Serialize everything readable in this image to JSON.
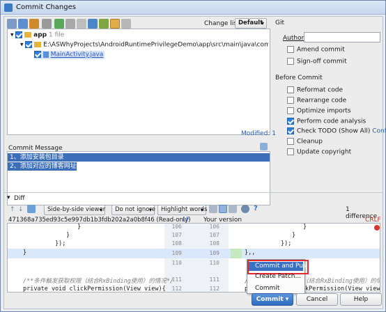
{
  "window": {
    "title": "Commit Changes"
  },
  "toolbar": {
    "changelist_label": "Change list:",
    "changelist_value": "Default"
  },
  "tree": {
    "root_label": "app",
    "root_count": "1 file",
    "path": "E:\\ASWhyProjects\\AndroidRuntimePrivilegeDemo\\app\\src\\main\\java\\com\\why\\project\\run",
    "file": "MainActivity.java"
  },
  "modified_text": "Modified: 1",
  "commit_message": {
    "label": "Commit Message",
    "lines": [
      "1、添加安装包目录",
      "2、添加对应的博客网址"
    ]
  },
  "git": {
    "section": "Git",
    "author_label": "Author:",
    "author_value": "",
    "amend": "Amend commit",
    "signoff": "Sign-off commit"
  },
  "before_commit": {
    "section": "Before Commit",
    "reformat": "Reformat code",
    "rearrange": "Rearrange code",
    "optimize": "Optimize imports",
    "analysis": "Perform code analysis",
    "todo": "Check TODO (Show All)",
    "configure": "Configure",
    "cleanup": "Cleanup",
    "copyright": "Update copyright"
  },
  "diff": {
    "section": "Diff",
    "viewer": "Side-by-side viewer",
    "ignore": "Do not ignore",
    "highlight": "Highlight words",
    "count": "1 difference",
    "left_title": "471368a735ed93c5e997db1b3fdb202a2a0b8f46 (Read-only)",
    "lf": "LF",
    "right_title": "Your version",
    "crlf": "CRLF",
    "left_lines": [
      "}",
      "}",
      "});",
      "}",
      "",
      "/**条件触发获取权限（结合RxBinding使用）的情况*/",
      "private void clickPermission(View view){"
    ],
    "right_lines": [
      "}",
      "}",
      "});",
      "},,",
      "",
      "/**条件触发获取权限（结合RxBinding使用）的情况*/",
      "private void clickPermission(View view){"
    ],
    "nums_left": [
      "106",
      "107",
      "108",
      "109",
      "110",
      "111",
      "112"
    ],
    "nums_right": [
      "106",
      "107",
      "108",
      "109",
      "110",
      "111",
      "112"
    ]
  },
  "popup": {
    "items": [
      "Commit and Push...",
      "Create Patch...",
      "Commit"
    ]
  },
  "buttons": {
    "commit": "Commit",
    "cancel": "Cancel",
    "help": "Help"
  }
}
